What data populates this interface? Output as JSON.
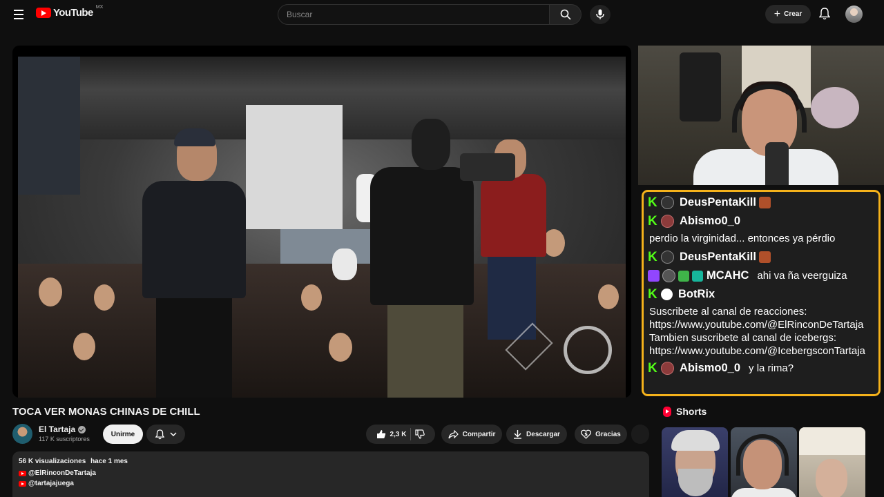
{
  "topbar": {
    "logo_text": "YouTube",
    "country_code": "MX",
    "search_placeholder": "Buscar",
    "create_label": "Crear"
  },
  "video": {
    "title": "TOCA VER MONAS CHINAS DE CHILL"
  },
  "channel": {
    "name": "El Tartaja",
    "subscribers": "117 K suscriptores",
    "join_label": "Unirme"
  },
  "actions": {
    "likes": "2,3 K",
    "share_label": "Compartir",
    "download_label": "Descargar",
    "thanks_label": "Gracias"
  },
  "description": {
    "views": "56 K visualizaciones",
    "date": "hace 1 mes",
    "links": [
      "@ElRinconDeTartaja",
      "@tartajajuega"
    ]
  },
  "chat": {
    "border_color": "#f5b21b",
    "messages": [
      {
        "platform": "kick",
        "user": "DeusPentaKill",
        "text": ""
      },
      {
        "platform": "kick",
        "user": "Abismo0_0",
        "text": ""
      },
      {
        "platform": "kick",
        "user": "",
        "text": "perdio la virginidad... entonces ya pérdio"
      },
      {
        "platform": "kick",
        "user": "DeusPentaKill",
        "text": ""
      },
      {
        "platform": "twitch",
        "user": "MCAHC",
        "text": "ahi va ña veerguiza"
      },
      {
        "platform": "kick",
        "user": "BotRix",
        "text": ""
      },
      {
        "platform": "kick",
        "user": "",
        "text": "Suscribete al canal de reacciones:"
      },
      {
        "platform": "kick",
        "user": "",
        "text": "https://www.youtube.com/@ElRinconDeTartaja"
      },
      {
        "platform": "kick",
        "user": "",
        "text": "Tambien suscribete al canal de icebergs:"
      },
      {
        "platform": "kick",
        "user": "",
        "text": "https://www.youtube.com/@IcebergsconTartaja"
      },
      {
        "platform": "kick",
        "user": "Abismo0_0",
        "text": "y la rima?"
      }
    ]
  },
  "shorts": {
    "heading": "Shorts"
  },
  "colors": {
    "brand_red": "#ff0000",
    "kick_green": "#53fc18",
    "twitch_purple": "#9146ff"
  }
}
